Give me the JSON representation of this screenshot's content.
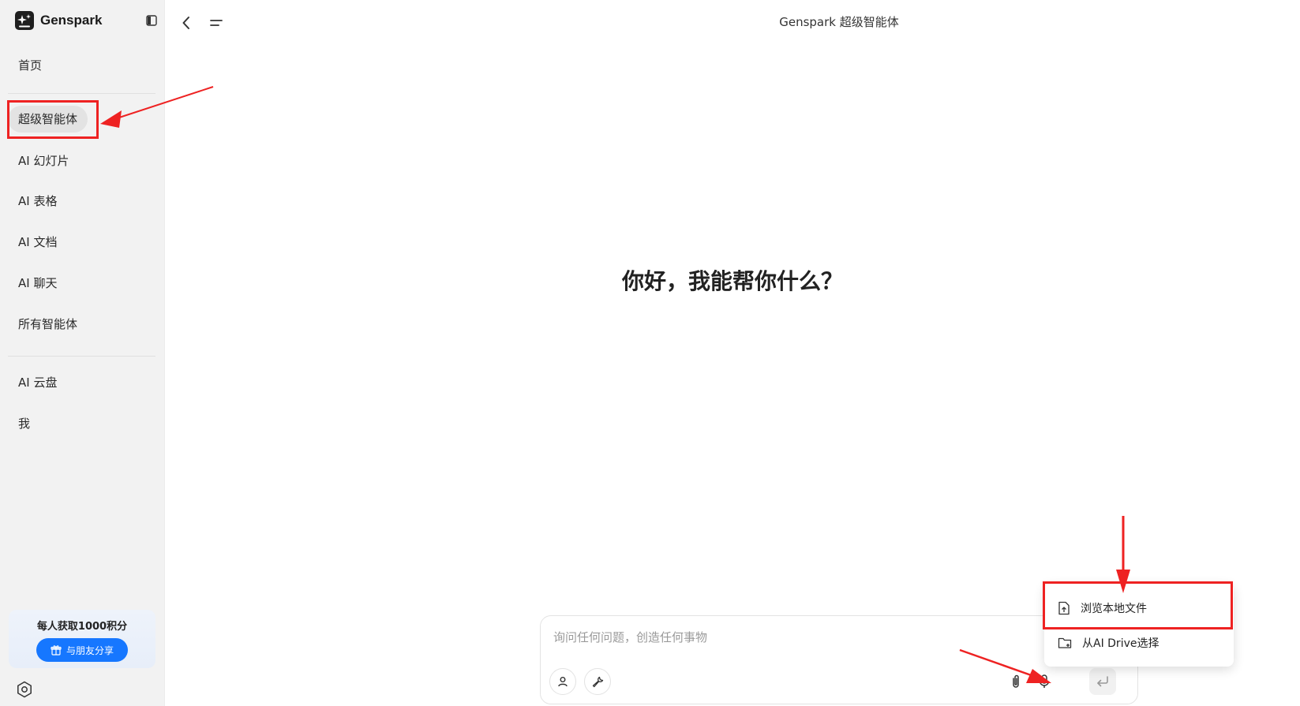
{
  "app": {
    "logo_text": "Genspark",
    "title": "Genspark 超级智能体"
  },
  "sidebar": {
    "items": [
      {
        "label": "首页"
      },
      {
        "label": "超级智能体"
      },
      {
        "label": "AI 幻灯片"
      },
      {
        "label": "AI 表格"
      },
      {
        "label": "AI 文档"
      },
      {
        "label": "AI 聊天"
      },
      {
        "label": "所有智能体"
      },
      {
        "label": "AI 云盘"
      },
      {
        "label": "我"
      }
    ],
    "active_item": "超级智能体",
    "promo": {
      "title": "每人获取1000积分",
      "button_label": "与朋友分享"
    }
  },
  "main": {
    "greeting": "你好，我能帮你什么？"
  },
  "composer": {
    "placeholder": "询问任何问题，创造任何事物",
    "value": ""
  },
  "attach_menu": {
    "items": [
      {
        "label": "浏览本地文件"
      },
      {
        "label": "从AI Drive选择"
      }
    ]
  },
  "icons": {
    "logo": "genspark-logo-icon",
    "panel_toggle": "sidebar-toggle-icon",
    "back": "chevron-left-icon",
    "menu": "menu-icon",
    "gift": "gift-icon",
    "settings": "settings-icon",
    "persona": "person-icon",
    "tools": "wrench-icon",
    "attach": "paperclip-icon",
    "mic": "microphone-icon",
    "send": "enter-icon",
    "upload_file": "file-upload-icon",
    "drive_folder": "folder-icon"
  },
  "colors": {
    "accent": "#1677ff",
    "annotation": "#ee2222",
    "sidebar_bg": "#f2f2f2",
    "active_item_bg": "#e3e3e3"
  }
}
